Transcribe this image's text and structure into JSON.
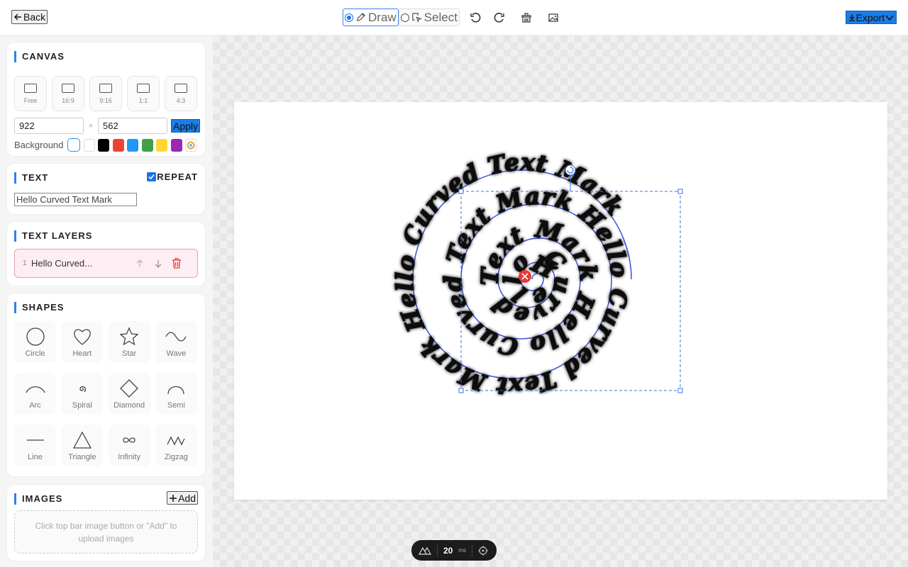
{
  "topbar": {
    "back_label": "Back",
    "modes": [
      {
        "label": "Draw",
        "active": true,
        "icon": "pencil-icon"
      },
      {
        "label": "Select",
        "active": false,
        "icon": "cursor-select-icon"
      }
    ],
    "icons": [
      "undo-icon",
      "redo-icon",
      "clear-icon",
      "image-icon"
    ],
    "export_label": "Export",
    "accent": "#1a7de8"
  },
  "canvas_panel": {
    "title": "CANVAS",
    "ratios": [
      "Free",
      "16:9",
      "9:16",
      "1:1",
      "4:3"
    ],
    "width": "922",
    "height": "562",
    "times": "×",
    "apply_label": "Apply",
    "background_label": "Background",
    "swatches": [
      "#ffffff",
      "#ffffff",
      "#000000",
      "#ea4335",
      "#2196f3",
      "#43a047",
      "#fdd835",
      "#9c27b0",
      "custom"
    ]
  },
  "text_panel": {
    "title": "TEXT",
    "repeat_label": "REPEAT",
    "repeat_checked": true,
    "text_value": "Hello Curved Text Mark"
  },
  "layers_panel": {
    "title": "TEXT LAYERS",
    "layers": [
      {
        "index": "1",
        "name": "Hello Curved..."
      }
    ]
  },
  "shapes_panel": {
    "title": "SHAPES",
    "shapes": [
      "Circle",
      "Heart",
      "Star",
      "Wave",
      "Arc",
      "Spiral",
      "Diamond",
      "Semi",
      "Line",
      "Triangle",
      "Infinity",
      "Zigzag"
    ]
  },
  "images_panel": {
    "title": "IMAGES",
    "add_label": "Add",
    "hint": "Click top bar image button or \"Add\" to upload images"
  },
  "artwork": {
    "repeated_text": "Hello Curved Text Mark Hello Curved Text Mark Hello Curved Text Mark Hello Curved Text Mark"
  },
  "perf": {
    "value": "20",
    "unit": "ms"
  }
}
